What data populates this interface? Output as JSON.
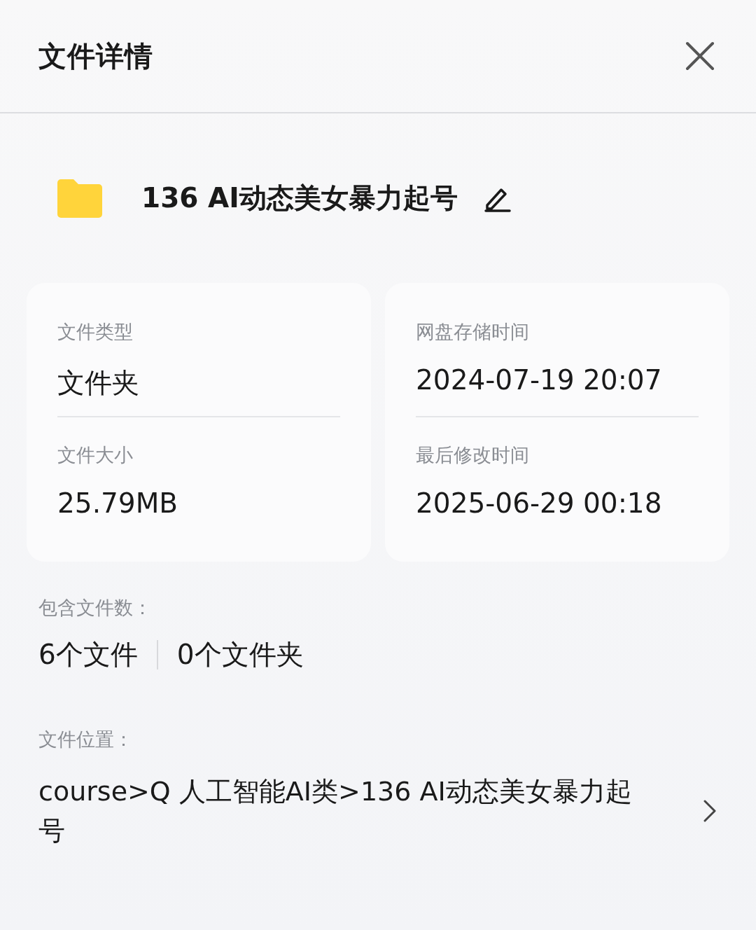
{
  "header": {
    "title": "文件详情"
  },
  "file": {
    "name": "136 AI动态美女暴力起号"
  },
  "details": [
    {
      "label": "文件类型",
      "value": "文件夹"
    },
    {
      "label": "网盘存储时间",
      "value": "2024-07-19 20:07"
    },
    {
      "label": "文件大小",
      "value": "25.79MB"
    },
    {
      "label": "最后修改时间",
      "value": "2025-06-29 00:18"
    }
  ],
  "contents": {
    "label": "包含文件数：",
    "files": "6个文件",
    "folders": "0个文件夹"
  },
  "location": {
    "label": "文件位置：",
    "path": "course>Q 人工智能AI类>136 AI动态美女暴力起号"
  }
}
